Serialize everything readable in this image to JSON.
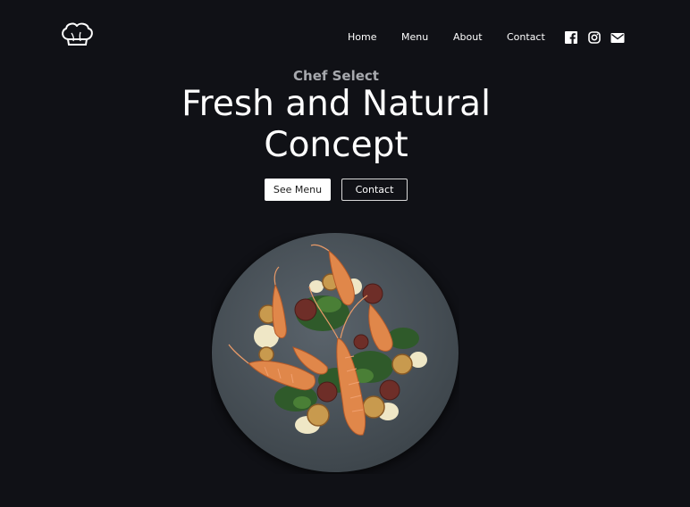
{
  "header": {
    "logo_icon": "chef-hat-icon",
    "nav": [
      {
        "label": "Home"
      },
      {
        "label": "Menu"
      },
      {
        "label": "About"
      },
      {
        "label": "Contact"
      }
    ],
    "social": [
      {
        "icon": "facebook-icon"
      },
      {
        "icon": "instagram-icon"
      },
      {
        "icon": "mail-icon"
      }
    ]
  },
  "hero": {
    "subtitle": "Chef Select",
    "title_line1": "Fresh and Natural",
    "title_line2": "Concept",
    "primary_button": "See Menu",
    "secondary_button": "Contact"
  },
  "image": {
    "subject": "langoustine-dish-on-slate-plate"
  },
  "colors": {
    "background": "#101116",
    "subtitle": "#a7a9ae",
    "plate": "#4a535a",
    "accent_orange": "#e0874a"
  }
}
